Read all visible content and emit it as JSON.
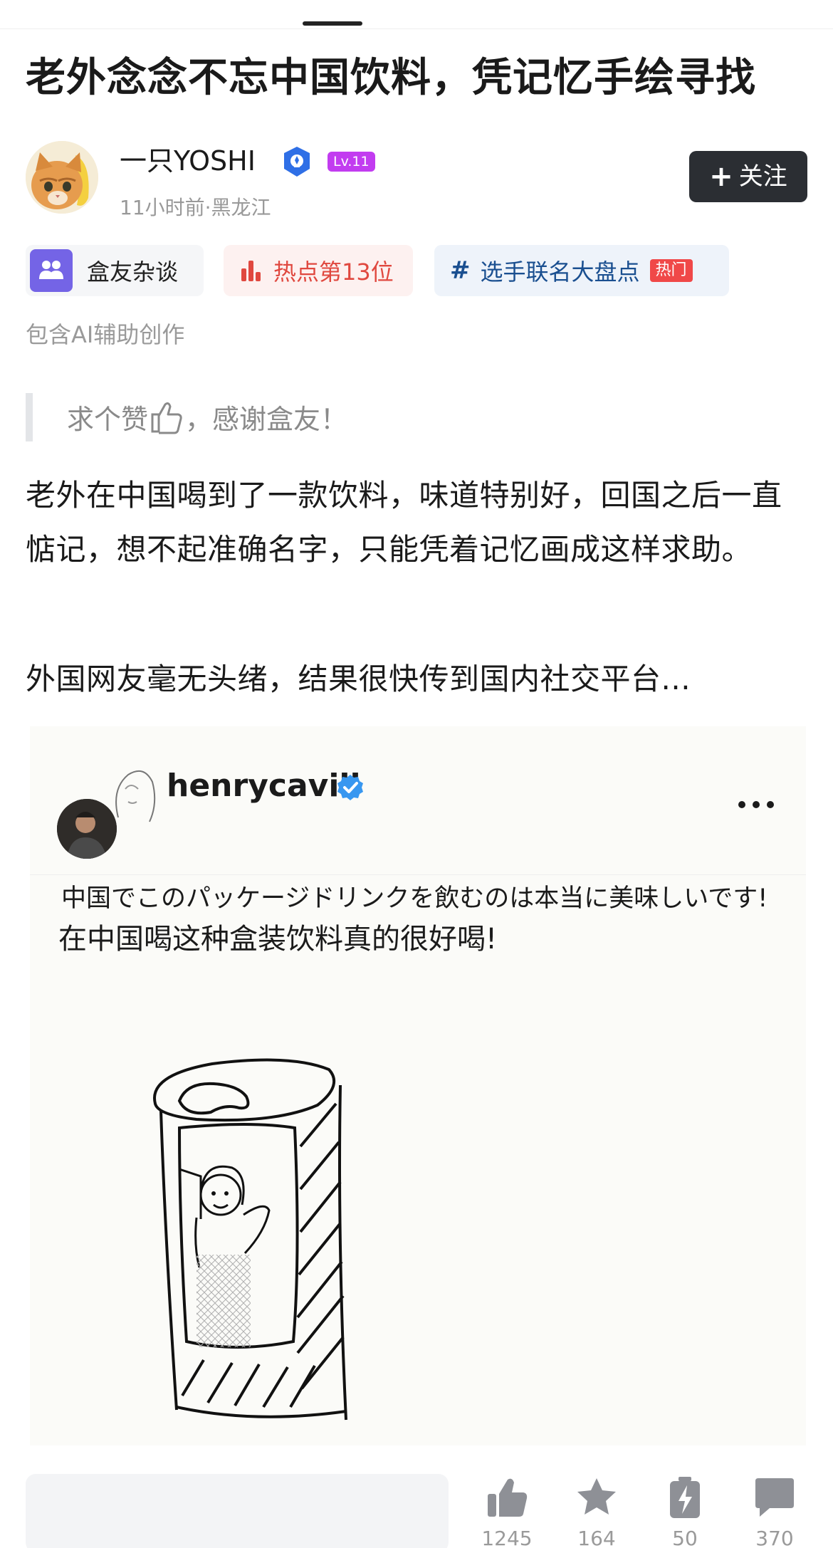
{
  "article": {
    "title": "老外念念不忘中国饮料，凭记忆手绘寻找",
    "author": {
      "name": "一只YOSHI",
      "level": "Lv.11",
      "meta": "11小时前·黑龙江"
    },
    "follow_label": "关注",
    "chips": {
      "group": "盒友杂谈",
      "hot_rank": "热点第13位",
      "topic": "选手联名大盘点",
      "topic_tag": "热门"
    },
    "ai_note": "包含AI辅助创作",
    "quote": {
      "before": "求个赞",
      "after": "，感谢盒友！"
    },
    "paragraphs": [
      "老外在中国喝到了一款饮料，味道特别好，回国之后一直惦记，想不起准确名字，只能凭着记忆画成这样求助。",
      "外国网友毫无头绪，结果很快传到国内社交平台..."
    ]
  },
  "embedded_post": {
    "username": "henrycavill",
    "caption_jp": "中国でこのパッケージドリンクを飲むのは本当に美味しいです!",
    "caption_cn": "在中国喝这种盒装饮料真的很好喝!"
  },
  "action_bar": {
    "comment_placeholder": "",
    "likes": "1245",
    "favorites": "164",
    "charges": "50",
    "comments": "370"
  },
  "colors": {
    "accent_dark": "#2b2e33",
    "level_badge": "#c23cf0",
    "hot_red": "#e0483f",
    "topic_blue": "#1a4f90",
    "verified_blue": "#3897f0",
    "group_purple": "#7464e6"
  },
  "icons": [
    "verified-icon",
    "plus-icon",
    "group-icon",
    "bar-chart-icon",
    "hash-icon",
    "thumbs-up-icon",
    "more-icon",
    "like-icon",
    "star-icon",
    "charge-icon",
    "comment-icon"
  ]
}
